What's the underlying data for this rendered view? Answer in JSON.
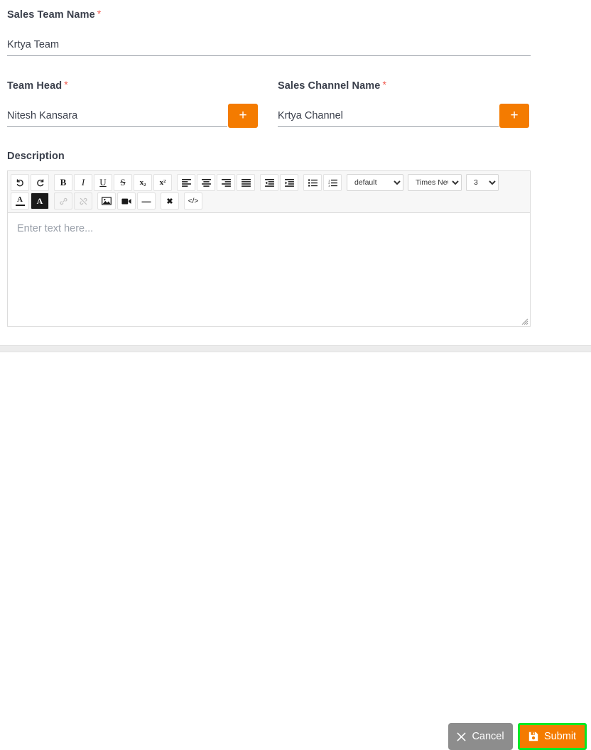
{
  "form": {
    "fields": [
      {
        "id": "sales-team-name",
        "label": "Sales Team Name",
        "required_marker": "*",
        "value": "Krtya Team",
        "placeholder": "Sales Team Name"
      },
      {
        "id": "team-head",
        "label": "Team Head",
        "required_marker": "*",
        "value": "Nitesh Kansara",
        "placeholder": "Team Head",
        "add_button_label": "+"
      },
      {
        "id": "sales-channel-name",
        "label": "Sales Channel Name",
        "required_marker": "*",
        "value": "Krtya Channel",
        "placeholder": "Sales Channel Name",
        "add_button_label": "+"
      }
    ],
    "description": {
      "label": "Description",
      "placeholder": "Enter text here...",
      "value": ""
    }
  },
  "editor": {
    "toolbar_row1": [
      {
        "name": "undo-icon",
        "title": "Undo",
        "glyph": "↶",
        "state": "enabled"
      },
      {
        "name": "redo-icon",
        "title": "Redo",
        "glyph": "↷",
        "state": "enabled"
      },
      {
        "name": "bold-icon",
        "title": "Bold",
        "glyph": "B",
        "state": "enabled"
      },
      {
        "name": "italic-icon",
        "title": "Italic",
        "glyph": "I",
        "state": "enabled"
      },
      {
        "name": "underline-icon",
        "title": "Underline",
        "glyph": "U",
        "state": "enabled"
      },
      {
        "name": "strikethrough-icon",
        "title": "Strikethrough",
        "glyph": "S",
        "state": "enabled"
      },
      {
        "name": "subscript-icon",
        "title": "Subscript",
        "glyph": "x₂",
        "state": "enabled"
      },
      {
        "name": "superscript-icon",
        "title": "Superscript",
        "glyph": "x²",
        "state": "enabled"
      },
      {
        "name": "align-left-icon",
        "title": "Align left",
        "glyph": "",
        "state": "enabled"
      },
      {
        "name": "align-center-icon",
        "title": "Align center",
        "glyph": "",
        "state": "enabled"
      },
      {
        "name": "align-right-icon",
        "title": "Align right",
        "glyph": "",
        "state": "enabled"
      },
      {
        "name": "align-justify-icon",
        "title": "Justify",
        "glyph": "",
        "state": "enabled"
      },
      {
        "name": "outdent-icon",
        "title": "Decrease indent",
        "glyph": "",
        "state": "enabled"
      },
      {
        "name": "indent-icon",
        "title": "Increase indent",
        "glyph": "",
        "state": "enabled"
      },
      {
        "name": "unordered-list-icon",
        "title": "Bulleted list",
        "glyph": "",
        "state": "enabled"
      },
      {
        "name": "ordered-list-icon",
        "title": "Numbered list",
        "glyph": "",
        "state": "enabled"
      }
    ],
    "selects": [
      {
        "name": "paragraph-style-select",
        "value": "default",
        "options": [
          "default"
        ]
      },
      {
        "name": "font-family-select",
        "value": "Times New",
        "options": [
          "Times New"
        ]
      },
      {
        "name": "font-size-select",
        "value": "3",
        "options": [
          "3"
        ]
      }
    ],
    "toolbar_row2": [
      {
        "name": "font-color-icon",
        "title": "Font color",
        "glyph": "A",
        "state": "enabled"
      },
      {
        "name": "background-color-icon",
        "title": "Background color",
        "glyph": "A",
        "state": "active"
      },
      {
        "name": "link-icon",
        "title": "Insert link",
        "glyph": "",
        "state": "disabled"
      },
      {
        "name": "unlink-icon",
        "title": "Remove link",
        "glyph": "",
        "state": "disabled"
      },
      {
        "name": "image-icon",
        "title": "Insert image",
        "glyph": "",
        "state": "enabled"
      },
      {
        "name": "video-icon",
        "title": "Insert video",
        "glyph": "",
        "state": "enabled"
      },
      {
        "name": "horizontal-rule-icon",
        "title": "Horizontal line",
        "glyph": "—",
        "state": "enabled"
      },
      {
        "name": "clear-format-icon",
        "title": "Clear formatting",
        "glyph": "✖",
        "state": "enabled"
      },
      {
        "name": "code-view-icon",
        "title": "Code view",
        "glyph": "</>",
        "state": "enabled"
      }
    ]
  },
  "footer": {
    "cancel_label": "Cancel",
    "submit_label": "Submit"
  },
  "colors": {
    "accent_orange": "#f47b00",
    "required_red": "#f0584c",
    "cancel_gray": "#8d8d8d",
    "highlight_green": "#00e824",
    "text": "#3a3f4b",
    "placeholder": "#9aa0aa",
    "divider": "#ececec"
  }
}
